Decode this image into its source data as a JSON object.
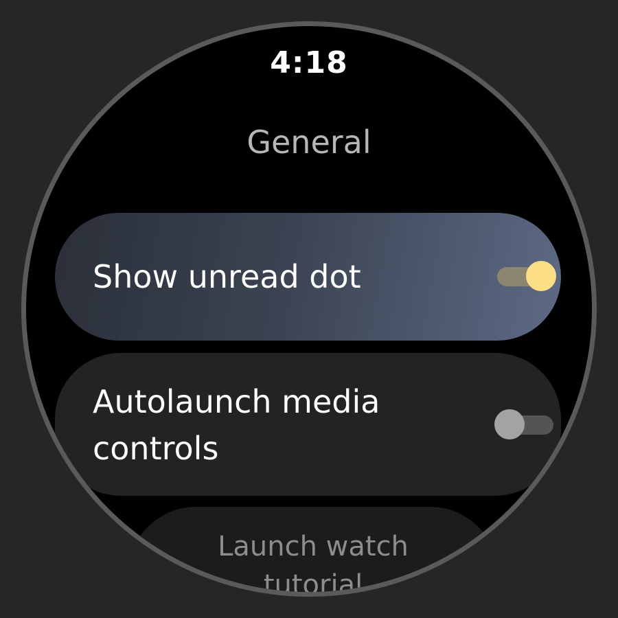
{
  "status_bar": {
    "time": "4:18"
  },
  "screen": {
    "title": "General"
  },
  "settings": [
    {
      "label": "Show unread dot",
      "toggle_state": "on"
    },
    {
      "label": "Autolaunch media controls",
      "label_lines": [
        "Autolaunch media",
        "controls"
      ],
      "toggle_state": "off"
    }
  ],
  "tutorial_button": {
    "label_lines": [
      "Launch watch",
      "tutorial"
    ]
  },
  "colors": {
    "toggle_on_thumb": "#fbde85",
    "toggle_on_track": "#8c8570",
    "toggle_off_thumb": "#a3a3a3",
    "toggle_off_track": "#545456",
    "highlight_chip_gradient_end": "#5d6a85"
  }
}
